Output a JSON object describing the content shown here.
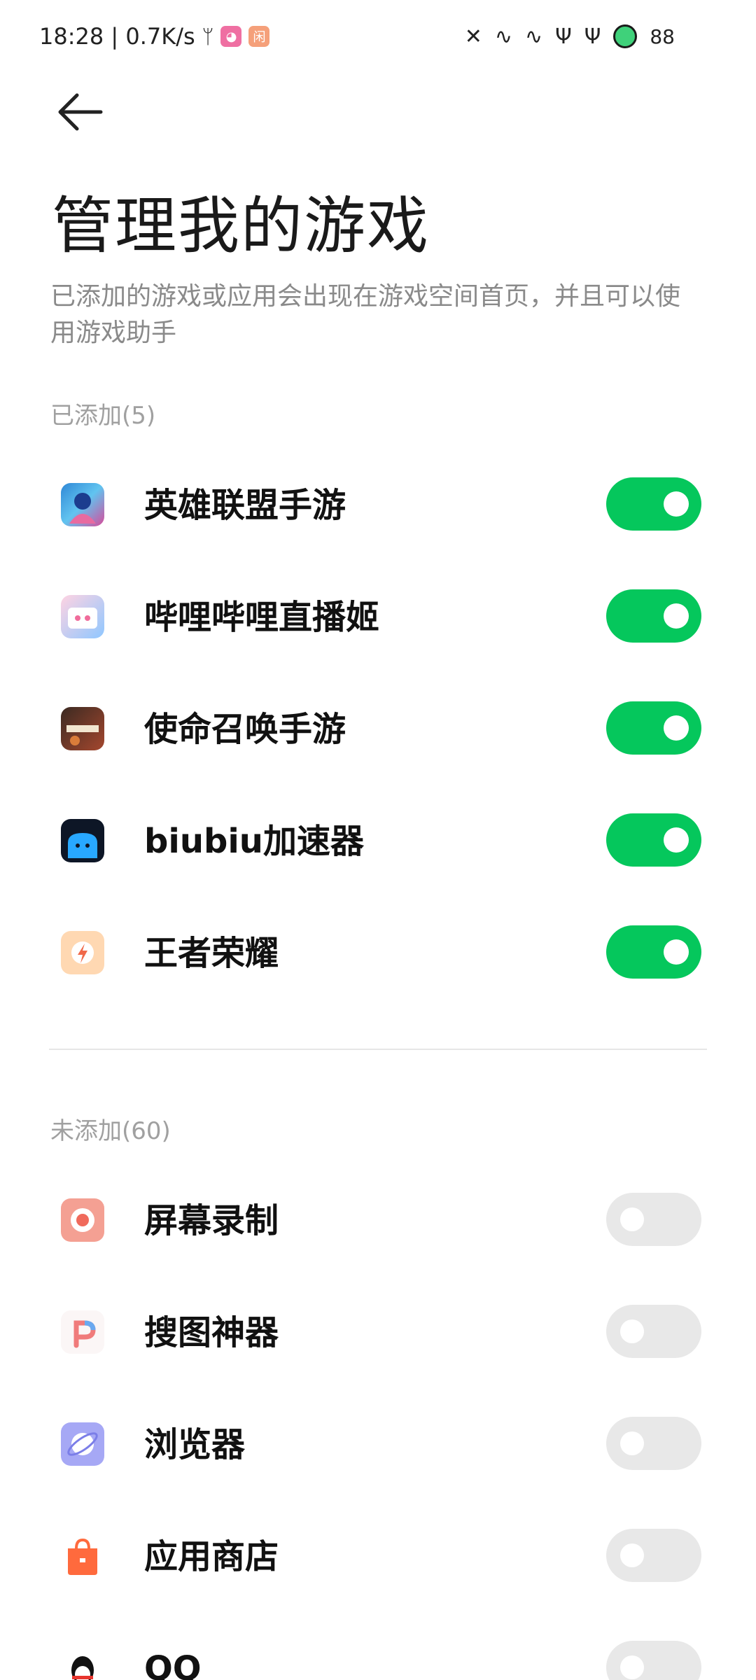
{
  "status_bar": {
    "time_speed": "18:28 | 0.7K/s",
    "notif_icon_1": "闲",
    "battery_level": "88"
  },
  "header": {
    "title": "管理我的游戏",
    "description": "已添加的游戏或应用会出现在游戏空间首页，并且可以使用游戏助手"
  },
  "added": {
    "label": "已添加(5)",
    "items": [
      {
        "name": "英雄联盟手游",
        "icon": "lol-icon",
        "enabled": true
      },
      {
        "name": "哔哩哔哩直播姬",
        "icon": "bilibili-live-icon",
        "enabled": true
      },
      {
        "name": "使命召唤手游",
        "icon": "codm-icon",
        "enabled": true
      },
      {
        "name": "biubiu加速器",
        "icon": "biubiu-icon",
        "enabled": true
      },
      {
        "name": "王者荣耀",
        "icon": "hok-icon",
        "enabled": true
      }
    ]
  },
  "not_added": {
    "label": "未添加(60)",
    "items": [
      {
        "name": "屏幕录制",
        "icon": "screen-record-icon",
        "enabled": false
      },
      {
        "name": "搜图神器",
        "icon": "image-search-icon",
        "enabled": false
      },
      {
        "name": "浏览器",
        "icon": "browser-icon",
        "enabled": false
      },
      {
        "name": "应用商店",
        "icon": "app-store-icon",
        "enabled": false
      },
      {
        "name": "QQ",
        "icon": "qq-icon",
        "enabled": false
      }
    ]
  },
  "colors": {
    "toggle_on": "#05c75c",
    "toggle_off": "#e8e8e8"
  }
}
